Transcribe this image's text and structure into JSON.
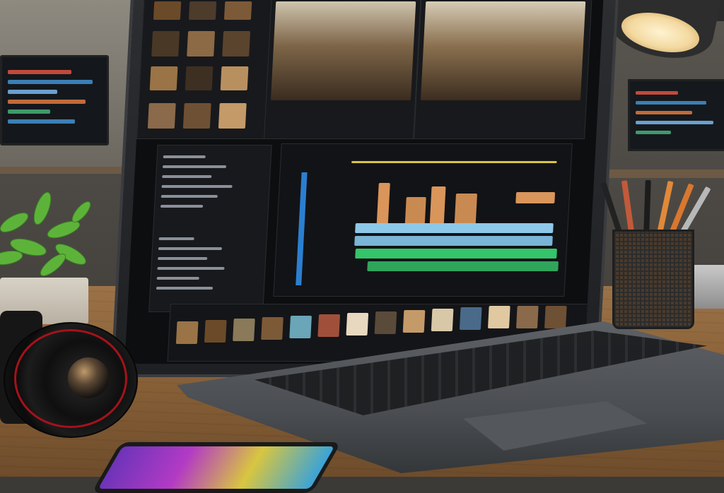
{
  "scene": {
    "description_tag": "",
    "accent_colors": {
      "timeline_blue": "#8ec8e8",
      "timeline_green": "#34c46a",
      "timeline_orange": "#d9955a",
      "ui_blue": "#2b7fd0",
      "desk_wood": "#8a6238",
      "lens_red": "#a5121b"
    }
  },
  "editor": {
    "preview_left_label": "",
    "preview_right_label": "",
    "timeline_title": "",
    "track_text_1": "",
    "track_text_2": ""
  },
  "icons": [
    "camera-icon",
    "plant-icon",
    "lamp-icon",
    "pencil-cup-icon",
    "laptop-icon",
    "tablet-icon"
  ]
}
